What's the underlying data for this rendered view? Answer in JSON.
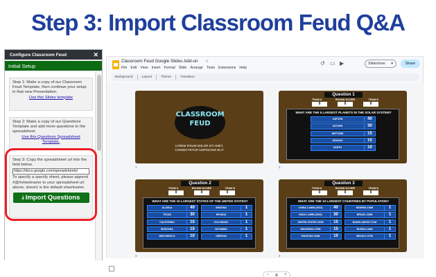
{
  "heading": "Step 3: Import Classroom Feud Q&A",
  "sidebar": {
    "header_title": "Configure Classroom Feud",
    "close_label": "✕",
    "section_title": "Initial Setup",
    "step1_text": "Step 1: Make a copy of our Classroom Feud Template, then continue your setup in that new Presentation.",
    "step1_link": "Use this Slides template",
    "step2_text": "Step 2: Make a copy of our Questions Template and add more questions to the spreadsheet.",
    "step2_link": "Use this Questions Spreadsheet Template.",
    "step3_text": "Step 3: Copy the spreadsheet url into the field below.",
    "step3_input_value": "https://docs.google.com/spreadsheets/",
    "step3_help": "To specify a specify sheet, please append #@#sheetname to your spreadsheet url above, sheet1 is the default sheetname.",
    "import_button": "Import Questions",
    "import_icon": "⤓"
  },
  "slides_app": {
    "doc_title": "Classroom Feud Google Slides Add-on",
    "menu": [
      "File",
      "Edit",
      "View",
      "Insert",
      "Format",
      "Slide",
      "Arrange",
      "Tools",
      "Extensions",
      "Help"
    ],
    "slideshow_label": "Slideshow",
    "share_label": "Share",
    "toolbar": [
      "Background",
      "Layout",
      "Theme",
      "Transition"
    ],
    "zoom_minus": "−",
    "zoom_plus": "+"
  },
  "slides": {
    "title_slide": {
      "title_line1": "CLASSROOM",
      "title_line2": "FEUD",
      "sub_line1": "LOREM IPSUM DOLOR SIT AMET,",
      "sub_line2": "CONSECTETUR ADIPISCING ELIT",
      "num": "1"
    },
    "q1": {
      "banner": "Question 1",
      "num": "2",
      "team_a": "TEAM A",
      "round_score": "ROUND SCORE",
      "team_b": "TEAM B",
      "score_a": "0",
      "score_round": "0",
      "score_b": "0",
      "question": "WHAT ARE THE 5 LARGEST PLANETS IN THE SOLAR SYSTEM?",
      "answers": [
        {
          "t": "JUPITER",
          "v": "40"
        },
        {
          "t": "SATURN",
          "v": "30"
        },
        {
          "t": "NEPTUNE",
          "v": "15"
        },
        {
          "t": "URANUS",
          "v": "15"
        },
        {
          "t": "EARTH",
          "v": "10"
        }
      ]
    },
    "q2": {
      "banner": "Question 2",
      "num": "3",
      "team_a": "TEAM A",
      "round_score": "ROUND SCORE",
      "team_b": "TEAM B",
      "score_a": "0",
      "score_round": "0",
      "score_b": "0",
      "question": "WHAT ARE THE 10 LARGEST STATES OF THE UNITED STATES?",
      "left": [
        {
          "t": "ALASKA",
          "v": "40"
        },
        {
          "t": "TEXAS",
          "v": "30"
        },
        {
          "t": "CALIFORNIA",
          "v": "15"
        },
        {
          "t": "MONTANA",
          "v": "15"
        },
        {
          "t": "NEW MEXICO",
          "v": "10"
        }
      ],
      "right": [
        {
          "t": "ARIZONA",
          "v": "1"
        },
        {
          "t": "NEVADA",
          "v": "1"
        },
        {
          "t": "COLORADO",
          "v": "1"
        },
        {
          "t": "WYOMING",
          "v": "1"
        },
        {
          "t": "OREGON",
          "v": "1"
        }
      ]
    },
    "q3": {
      "banner": "Question 3",
      "num": "4",
      "team_a": "TEAM A",
      "round_score": "ROUND SCORE",
      "team_b": "TEAM B",
      "score_a": "0",
      "score_round": "0",
      "score_b": "0",
      "question": "WHAT ARE THE 10 LARGEST COUNTRIES BY POPULATION?",
      "left": [
        {
          "t": "CHINA 1.43BN (2022)",
          "v": "40"
        },
        {
          "t": "INDIA 1.42BN (2022)",
          "v": "30"
        },
        {
          "t": "UNITED STATES 337M",
          "v": "15"
        },
        {
          "t": "INDONESIA 275M",
          "v": "15"
        },
        {
          "t": "PAKISTAN 234M",
          "v": "10"
        }
      ],
      "right": [
        {
          "t": "NIGERIA 216M",
          "v": "1"
        },
        {
          "t": "BRAZIL 215M",
          "v": "1"
        },
        {
          "t": "BANGLADESH 171M",
          "v": "1"
        },
        {
          "t": "RUSSIA 144M",
          "v": "1"
        },
        {
          "t": "MEXICO 127M",
          "v": "1"
        }
      ]
    }
  }
}
